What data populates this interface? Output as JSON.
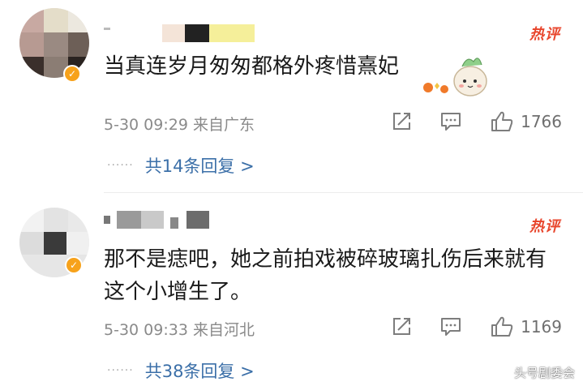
{
  "comments": [
    {
      "hot_label": "热评",
      "text": "当真连岁月匆匆都格外疼惜熹妃",
      "time": "5-30 09:29",
      "location": "来自广东",
      "like_count": "1766",
      "replies_label": "共14条回复 >",
      "icons": [
        "share-icon",
        "comment-icon",
        "like-icon"
      ]
    },
    {
      "hot_label": "热评",
      "text": "那不是痣吧，她之前拍戏被碎玻璃扎伤后来就有这个小增生了。",
      "time": "5-30 09:33",
      "location": "来自河北",
      "like_count": "1169",
      "replies_label": "共38条回复 >",
      "icons": [
        "share-icon",
        "comment-icon",
        "like-icon"
      ]
    }
  ],
  "watermark": "头号剧委会",
  "colors": {
    "hot": "#e8462d",
    "link": "#3b6fa8",
    "meta": "#8a8a8a",
    "badge": "#f7a21b"
  }
}
